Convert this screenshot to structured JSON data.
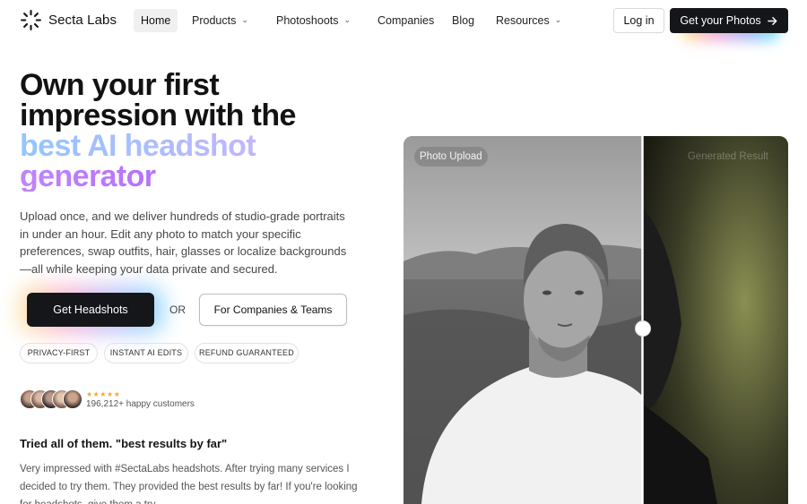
{
  "nav": {
    "brand": "Secta Labs",
    "items": [
      {
        "label": "Home",
        "chevron": false
      },
      {
        "label": "Products",
        "chevron": true
      },
      {
        "label": "Photoshoots",
        "chevron": true
      },
      {
        "label": "Companies",
        "chevron": false
      },
      {
        "label": "Blog",
        "chevron": false
      },
      {
        "label": "Resources",
        "chevron": true
      }
    ],
    "login_label": "Log in",
    "cta_label": "Get your Photos",
    "cta_icon": "arrow-right-icon"
  },
  "hero": {
    "headline_line1": "Own your first",
    "headline_line2": "impression with the",
    "headline_line3": "best AI headshot",
    "headline_line4": "generator",
    "subtext": "Upload once, and we deliver hundreds of studio-grade portraits in under an hour. Edit any photo to match your specific preferences, swap outfits, hair, glasses or localize backgrounds—all while keeping your data private and secured.",
    "primary_cta": "Get Headshots",
    "or_text": "OR",
    "secondary_cta": "For Companies & Teams",
    "badges": [
      "PRIVACY-FIRST",
      "INSTANT AI EDITS",
      "REFUND GUARANTEED"
    ],
    "rating_stars": "★★★★★",
    "customers_text": "196,212+ happy customers"
  },
  "testimonial": {
    "title": "Tried all of them. \"best results by far\"",
    "body": "Very impressed with #SectaLabs headshots. After trying many services I decided to try them. They provided the best results by far! If you're looking for headshots, give them a try."
  },
  "comparison": {
    "left_label": "Photo Upload",
    "right_label": "Generated Result",
    "slider_position": 0.62
  },
  "colors": {
    "dark_button": "#15161a",
    "gradient_start": "#93c5fd",
    "gradient_end": "#a855f7",
    "star": "#f2a93b"
  }
}
